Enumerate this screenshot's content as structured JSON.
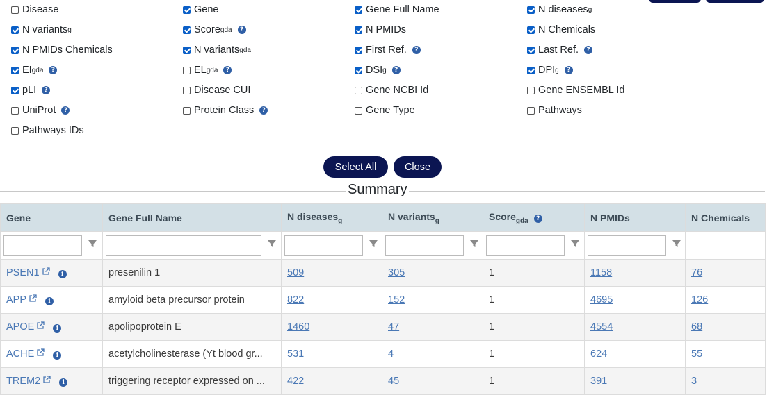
{
  "column_options": [
    {
      "label": "Disease",
      "sub": "",
      "checked": false,
      "help": false
    },
    {
      "label": "Gene",
      "sub": "",
      "checked": true,
      "help": false
    },
    {
      "label": "Gene Full Name",
      "sub": "",
      "checked": true,
      "help": false
    },
    {
      "label": "N diseases",
      "sub": "g",
      "checked": true,
      "help": false
    },
    {
      "label": "N variants",
      "sub": "g",
      "checked": true,
      "help": false
    },
    {
      "label": "Score",
      "sub": "gda",
      "checked": true,
      "help": true
    },
    {
      "label": "N PMIDs",
      "sub": "",
      "checked": true,
      "help": false
    },
    {
      "label": "N Chemicals",
      "sub": "",
      "checked": true,
      "help": false
    },
    {
      "label": "N PMIDs Chemicals",
      "sub": "",
      "checked": true,
      "help": false
    },
    {
      "label": "N variants",
      "sub": "gda",
      "checked": true,
      "help": false
    },
    {
      "label": "First Ref.",
      "sub": "",
      "checked": true,
      "help": true
    },
    {
      "label": "Last Ref.",
      "sub": "",
      "checked": true,
      "help": true
    },
    {
      "label": "EI",
      "sub": "gda",
      "checked": true,
      "help": true
    },
    {
      "label": "EL",
      "sub": "gda",
      "checked": false,
      "help": true
    },
    {
      "label": "DSI",
      "sub": "g",
      "checked": true,
      "help": true
    },
    {
      "label": "DPI",
      "sub": "g",
      "checked": true,
      "help": true
    },
    {
      "label": "pLI",
      "sub": "",
      "checked": true,
      "help": true
    },
    {
      "label": "Disease CUI",
      "sub": "",
      "checked": false,
      "help": false
    },
    {
      "label": "Gene NCBI Id",
      "sub": "",
      "checked": false,
      "help": false
    },
    {
      "label": "Gene ENSEMBL Id",
      "sub": "",
      "checked": false,
      "help": false
    },
    {
      "label": "UniProt",
      "sub": "",
      "checked": false,
      "help": true
    },
    {
      "label": "Protein Class",
      "sub": "",
      "checked": false,
      "help": true
    },
    {
      "label": "Gene Type",
      "sub": "",
      "checked": false,
      "help": false
    },
    {
      "label": "Pathways",
      "sub": "",
      "checked": false,
      "help": false
    },
    {
      "label": "Pathways IDs",
      "sub": "",
      "checked": false,
      "help": false
    }
  ],
  "help_glyph": "?",
  "info_glyph": "i",
  "buttons": {
    "select_all": "Select All",
    "close": "Close"
  },
  "summary_title": "Summary",
  "table": {
    "headers": [
      {
        "label": "Gene",
        "sub": "",
        "help": false
      },
      {
        "label": "Gene Full Name",
        "sub": "",
        "help": false
      },
      {
        "label": "N diseases",
        "sub": "g",
        "help": false
      },
      {
        "label": "N variants",
        "sub": "g",
        "help": false
      },
      {
        "label": "Score",
        "sub": "gda",
        "help": true
      },
      {
        "label": "N PMIDs",
        "sub": "",
        "help": false
      },
      {
        "label": "N Chemicals",
        "sub": "",
        "help": false
      }
    ],
    "rows": [
      {
        "gene": "PSEN1",
        "full_name": "presenilin 1",
        "n_diseases": "509",
        "n_variants": "305",
        "score": "1",
        "n_pmids": "1158",
        "n_chemicals": "76"
      },
      {
        "gene": "APP",
        "full_name": "amyloid beta precursor protein",
        "n_diseases": "822",
        "n_variants": "152",
        "score": "1",
        "n_pmids": "4695",
        "n_chemicals": "126"
      },
      {
        "gene": "APOE",
        "full_name": "apolipoprotein E",
        "n_diseases": "1460",
        "n_variants": "47",
        "score": "1",
        "n_pmids": "4554",
        "n_chemicals": "68"
      },
      {
        "gene": "ACHE",
        "full_name": "acetylcholinesterase (Yt blood gr...",
        "n_diseases": "531",
        "n_variants": "4",
        "score": "1",
        "n_pmids": "624",
        "n_chemicals": "55"
      },
      {
        "gene": "TREM2",
        "full_name": "triggering receptor expressed on ...",
        "n_diseases": "422",
        "n_variants": "45",
        "score": "1",
        "n_pmids": "391",
        "n_chemicals": "3"
      }
    ]
  },
  "colors": {
    "accent": "#0b1552",
    "header_bg": "#d3e0e6",
    "link": "#4a78b5",
    "checkbox": "#0a5fc7"
  }
}
